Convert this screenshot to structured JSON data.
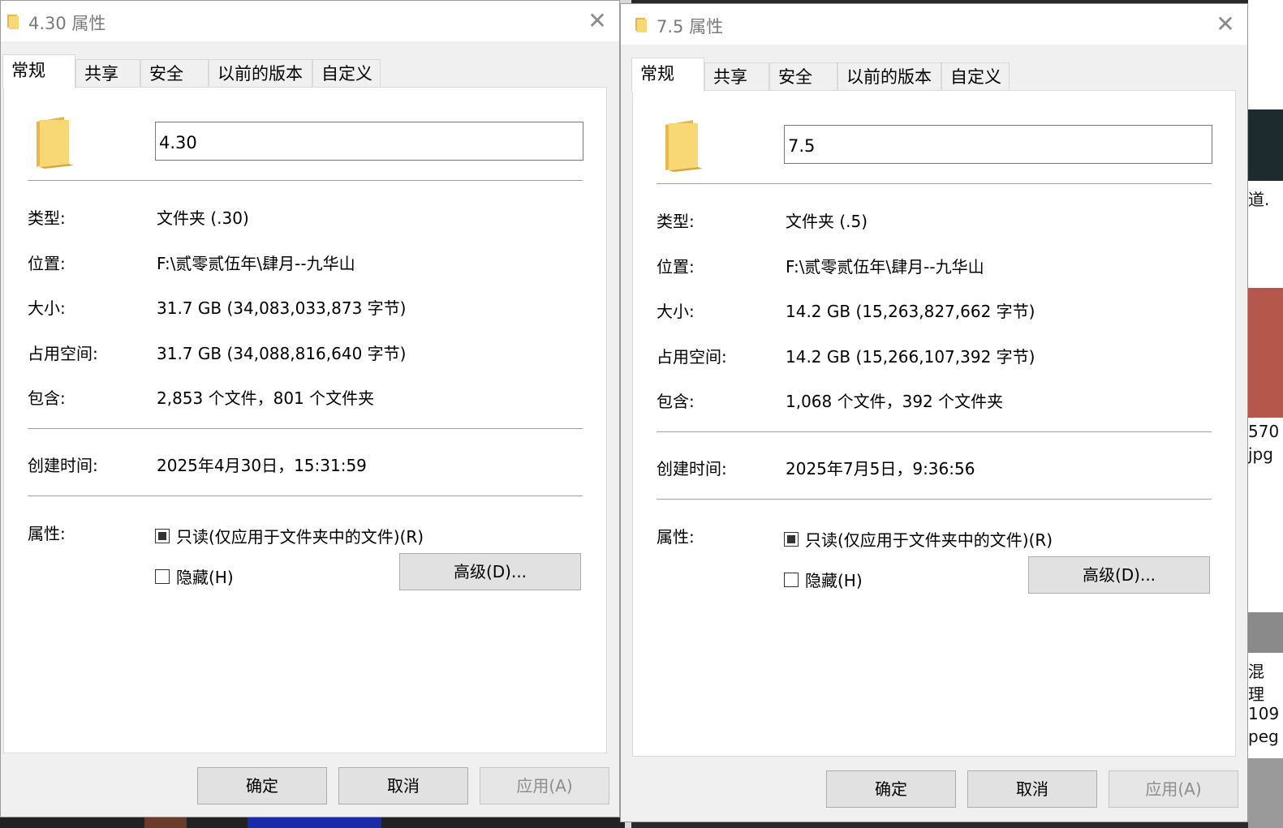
{
  "dialogs": [
    {
      "title": "4.30 属性",
      "tabs": [
        "常规",
        "共享",
        "安全",
        "以前的版本",
        "自定义"
      ],
      "folder_name": "4.30",
      "props": {
        "type_label": "类型:",
        "type_value": "文件夹 (.30)",
        "location_label": "位置:",
        "location_value": "F:\\贰零贰伍年\\肆月--九华山",
        "size_label": "大小:",
        "size_value": "31.7 GB (34,083,033,873 字节)",
        "disk_label": "占用空间:",
        "disk_value": "31.7 GB (34,088,816,640 字节)",
        "contains_label": "包含:",
        "contains_value": "2,853 个文件，801 个文件夹",
        "created_label": "创建时间:",
        "created_value": "2025年4月30日，15:31:59",
        "attr_label": "属性:",
        "readonly_label": "只读(仅应用于文件夹中的文件)(R)",
        "readonly_state": "indeterminate",
        "hidden_label": "隐藏(H)",
        "hidden_checked": false,
        "advanced_label": "高级(D)..."
      },
      "buttons": {
        "ok": "确定",
        "cancel": "取消",
        "apply": "应用(A)"
      }
    },
    {
      "title": "7.5 属性",
      "tabs": [
        "常规",
        "共享",
        "安全",
        "以前的版本",
        "自定义"
      ],
      "folder_name": "7.5",
      "props": {
        "type_label": "类型:",
        "type_value": "文件夹 (.5)",
        "location_label": "位置:",
        "location_value": "F:\\贰零贰伍年\\肆月--九华山",
        "size_label": "大小:",
        "size_value": "14.2 GB (15,263,827,662 字节)",
        "disk_label": "占用空间:",
        "disk_value": "14.2 GB (15,266,107,392 字节)",
        "contains_label": "包含:",
        "contains_value": "1,068 个文件，392 个文件夹",
        "created_label": "创建时间:",
        "created_value": "2025年7月5日，9:36:56",
        "attr_label": "属性:",
        "readonly_label": "只读(仅应用于文件夹中的文件)(R)",
        "readonly_state": "indeterminate",
        "hidden_label": "隐藏(H)",
        "hidden_checked": false,
        "advanced_label": "高级(D)..."
      },
      "buttons": {
        "ok": "确定",
        "cancel": "取消",
        "apply": "应用(A)"
      }
    }
  ],
  "background": {
    "items": [
      "道.",
      "570",
      "jpg",
      "混",
      "理",
      "109",
      "peg"
    ]
  },
  "colors": {
    "folder_yellow": "#f8d775",
    "folder_yellow_dark": "#e8b84a",
    "dialog_bg": "#f0f0f0",
    "panel_bg": "#ffffff"
  },
  "icons": {
    "folder": "folder-icon",
    "close": "close-icon",
    "checkbox": "checkbox-icon"
  }
}
